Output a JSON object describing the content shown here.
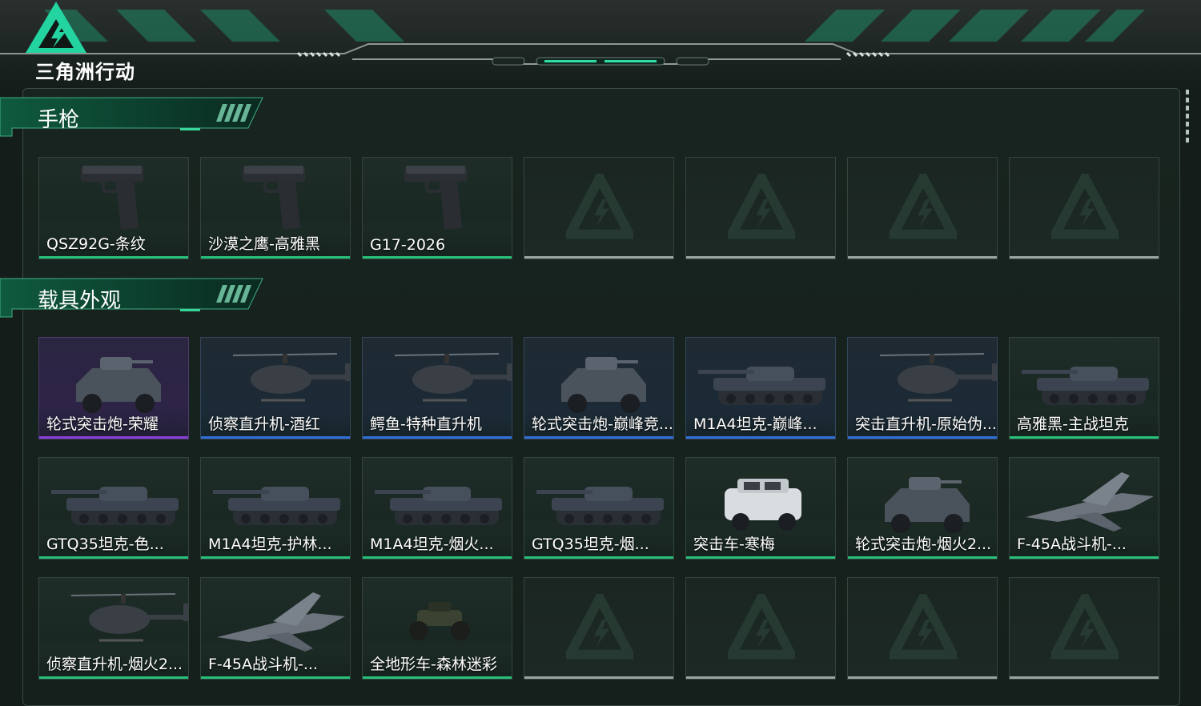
{
  "brand": {
    "logo_text": "三角洲行动",
    "accent": "#1fd39a"
  },
  "colors": {
    "green_bar": "#27c07a",
    "blue_bar": "#2f6fd6",
    "purple_bar": "#8a3fd6",
    "empty_bar": "#9aa5a0"
  },
  "sections": [
    {
      "title": "手枪",
      "items": [
        {
          "label": "QSZ92G-条纹",
          "rarity": "green",
          "icon": "pistol-icon"
        },
        {
          "label": "沙漠之鹰-高雅黑",
          "rarity": "green",
          "icon": "pistol-icon"
        },
        {
          "label": "G17-2026",
          "rarity": "green",
          "icon": "pistol-icon"
        },
        {
          "label": "",
          "rarity": "empty",
          "icon": "empty-slot-icon"
        },
        {
          "label": "",
          "rarity": "empty",
          "icon": "empty-slot-icon"
        },
        {
          "label": "",
          "rarity": "empty",
          "icon": "empty-slot-icon"
        },
        {
          "label": "",
          "rarity": "empty",
          "icon": "empty-slot-icon"
        }
      ]
    },
    {
      "title": "载具外观",
      "items": [
        {
          "label": "轮式突击炮-荣耀",
          "rarity": "purple",
          "icon": "armored-car-icon"
        },
        {
          "label": "侦察直升机-酒红",
          "rarity": "blue",
          "icon": "helicopter-icon"
        },
        {
          "label": "鳄鱼-特种直升机",
          "rarity": "blue",
          "icon": "helicopter-icon"
        },
        {
          "label": "轮式突击炮-巅峰竞...",
          "rarity": "blue",
          "icon": "armored-car-icon"
        },
        {
          "label": "M1A4坦克-巅峰...",
          "rarity": "blue",
          "icon": "tank-icon"
        },
        {
          "label": "突击直升机-原始伪...",
          "rarity": "blue",
          "icon": "helicopter-icon"
        },
        {
          "label": "高雅黑-主战坦克",
          "rarity": "green",
          "icon": "tank-icon"
        },
        {
          "label": "GTQ35坦克-色...",
          "rarity": "green",
          "icon": "tank-icon"
        },
        {
          "label": "M1A4坦克-护林...",
          "rarity": "green",
          "icon": "tank-icon"
        },
        {
          "label": "M1A4坦克-烟火...",
          "rarity": "green",
          "icon": "tank-icon"
        },
        {
          "label": "GTQ35坦克-烟...",
          "rarity": "green",
          "icon": "tank-icon"
        },
        {
          "label": "突击车-寒梅",
          "rarity": "green",
          "icon": "assault-vehicle-icon"
        },
        {
          "label": "轮式突击炮-烟火2...",
          "rarity": "green",
          "icon": "armored-car-icon"
        },
        {
          "label": "F-45A战斗机-...",
          "rarity": "green",
          "icon": "fighter-jet-icon"
        },
        {
          "label": "侦察直升机-烟火2...",
          "rarity": "green",
          "icon": "helicopter-icon"
        },
        {
          "label": "F-45A战斗机-...",
          "rarity": "green",
          "icon": "fighter-jet-icon"
        },
        {
          "label": "全地形车-森林迷彩",
          "rarity": "green",
          "icon": "atv-icon"
        },
        {
          "label": "",
          "rarity": "empty",
          "icon": "empty-slot-icon"
        },
        {
          "label": "",
          "rarity": "empty",
          "icon": "empty-slot-icon"
        },
        {
          "label": "",
          "rarity": "empty",
          "icon": "empty-slot-icon"
        },
        {
          "label": "",
          "rarity": "empty",
          "icon": "empty-slot-icon"
        }
      ]
    }
  ]
}
